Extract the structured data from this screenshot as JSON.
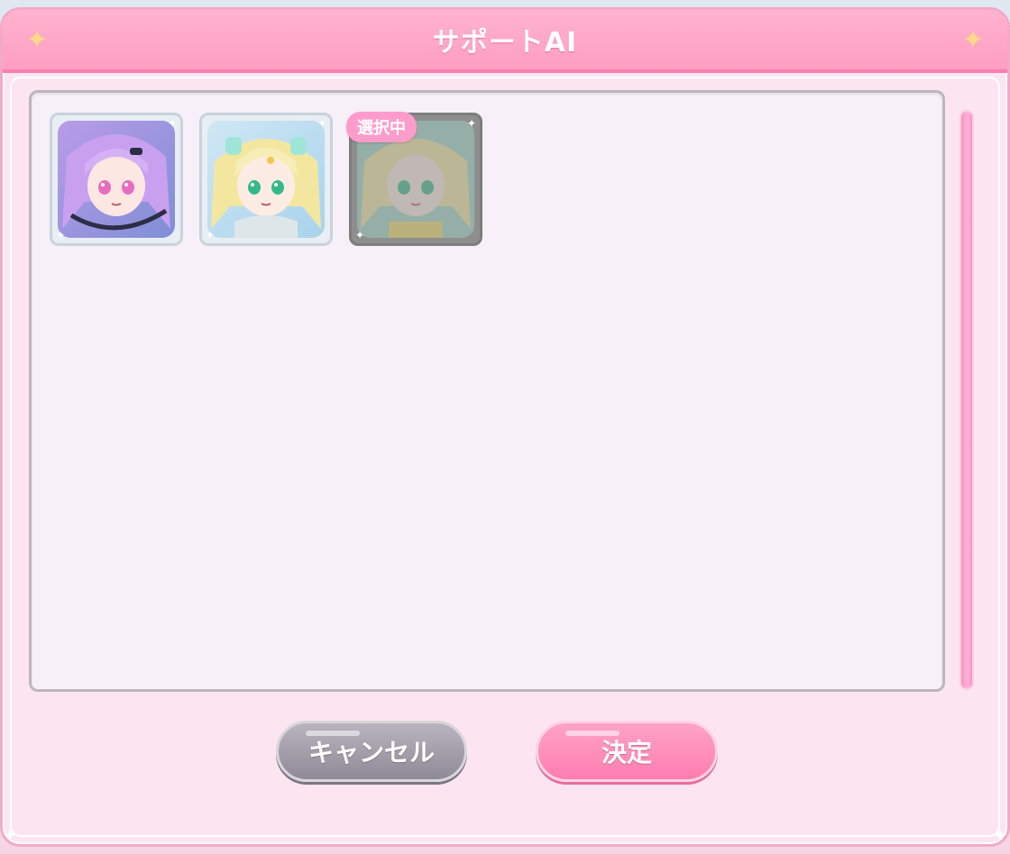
{
  "dialog": {
    "title": "サポートAI",
    "sparkle_icon": "sparkle-icon"
  },
  "support_ai_list": {
    "items": [
      {
        "name": "character-1",
        "hair_color": "#c9a0f0",
        "accent": "#e6c7ff",
        "selected": false
      },
      {
        "name": "character-2",
        "hair_color": "#f3e7a0",
        "accent": "#9fe6d8",
        "selected": false
      },
      {
        "name": "character-3",
        "hair_color": "#f3e7a0",
        "accent": "#9fe6d8",
        "selected": true
      }
    ],
    "selected_tag": "選択中"
  },
  "buttons": {
    "cancel_label": "キャンセル",
    "confirm_label": "決定"
  },
  "colors": {
    "title_bar": "#ff9ec2",
    "dialog_bg": "#fde4f1",
    "panel_bg": "#f7f0f8",
    "confirm": "#ff7db0",
    "cancel": "#8f8a97",
    "scrollbar": "#ff8fc1"
  }
}
